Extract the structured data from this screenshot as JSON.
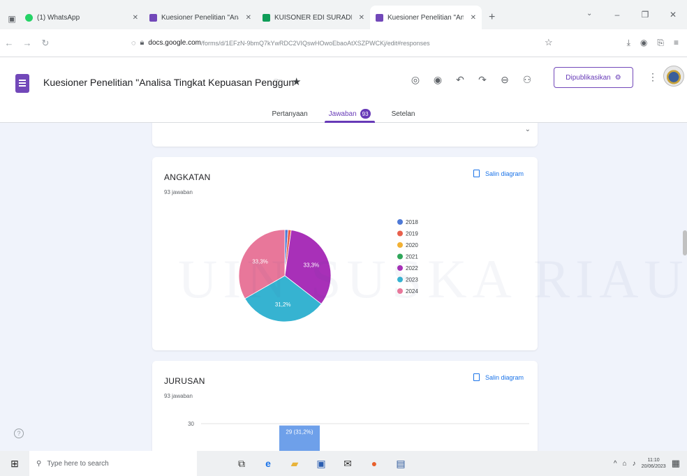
{
  "browser": {
    "tabs": [
      {
        "title": "(1) WhatsApp",
        "color": "#25d366"
      },
      {
        "title": "Kuesioner Penelitian \"Analisa Tingk",
        "color": "#7248b9"
      },
      {
        "title": "KUISONER EDI SURADI - Goog",
        "color": "#0f9d58"
      },
      {
        "title": "Kuesioner Penelitian \"Analisa Ti",
        "color": "#7248b9"
      }
    ],
    "url_domain": "docs.google.com",
    "url_path": "/forms/d/1EFzN-9bmQ7kYwRDC2VIQswHOwoEbaoAtXSZPWCKj/edit#responses"
  },
  "form": {
    "title": "Kuesioner Penelitian \"Analisa Tingkat Kepuasan Penggun",
    "publish_label": "Dipublikasikan",
    "tabs": [
      {
        "label": "Pertanyaan"
      },
      {
        "label": "Jawaban",
        "badge": "93"
      },
      {
        "label": "Setelan"
      }
    ]
  },
  "questions": [
    {
      "title": "ANGKATAN",
      "count": "93 jawaban",
      "copy_label": "Salin diagram"
    },
    {
      "title": "JURUSAN",
      "count": "93 jawaban",
      "copy_label": "Salin diagram"
    }
  ],
  "chart_data": [
    {
      "type": "pie",
      "title": "ANGKATAN",
      "labels": [
        "2018",
        "2019",
        "2020",
        "2021",
        "2022",
        "2023",
        "2024"
      ],
      "values": [
        1.1,
        1.1,
        0,
        0,
        33.3,
        31.2,
        33.3
      ],
      "value_labels": [
        "",
        "",
        "",
        "",
        "33,3%",
        "31,2%",
        "33,3%"
      ],
      "colors": [
        "#4e79d6",
        "#e8604c",
        "#f2b134",
        "#2fa65a",
        "#a830b8",
        "#36b3d1",
        "#e8779a"
      ],
      "legend": "right"
    },
    {
      "type": "bar",
      "title": "JURUSAN",
      "ytick": 30,
      "bars": [
        {
          "value": 29,
          "label": "29 (31,2%)",
          "color": "#6ea0ea"
        }
      ]
    }
  ],
  "watermark": "UIN SUSKA RIAU",
  "taskbar": {
    "search_placeholder": "Type here to search",
    "time": "11:10",
    "date": "20/06/2023"
  }
}
